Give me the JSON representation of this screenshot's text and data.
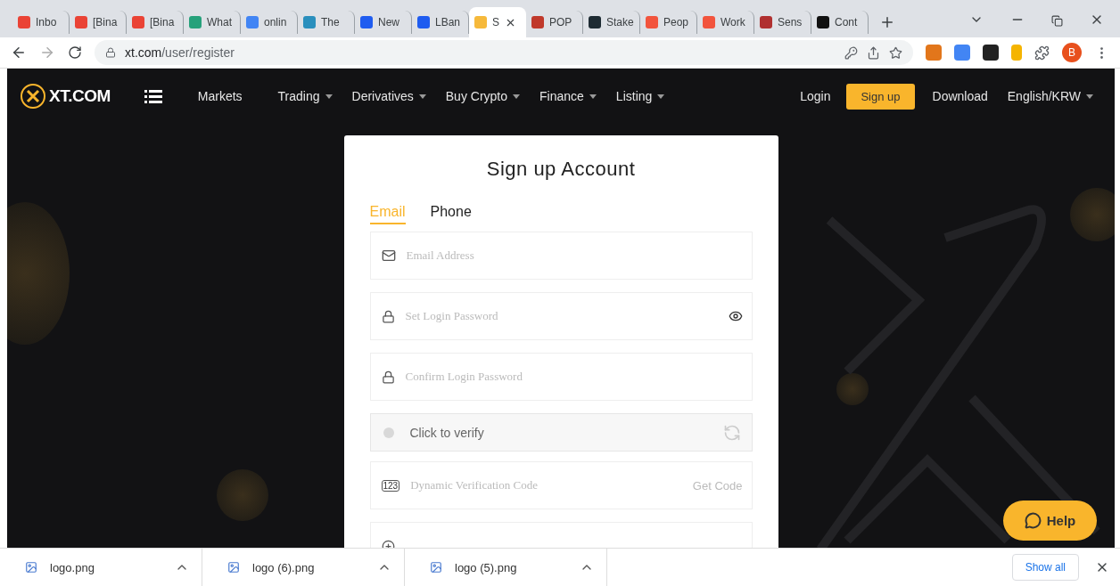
{
  "browser": {
    "tabs": [
      {
        "title": "Inbo",
        "color": "#ea4335",
        "selected": false
      },
      {
        "title": "[Bina",
        "color": "#ea4335",
        "selected": false
      },
      {
        "title": "[Bina",
        "color": "#ea4335",
        "selected": false
      },
      {
        "title": "What",
        "color": "#26a17b",
        "selected": false
      },
      {
        "title": "onlin",
        "color": "#4285f4",
        "selected": false
      },
      {
        "title": "The",
        "color": "#2a8fbd",
        "selected": false
      },
      {
        "title": "New",
        "color": "#1f5cf0",
        "selected": false
      },
      {
        "title": "LBan",
        "color": "#1f5cf0",
        "selected": false
      },
      {
        "title": "S",
        "color": "#f6b93b",
        "selected": true
      },
      {
        "title": "POP",
        "color": "#c0392b",
        "selected": false
      },
      {
        "title": "Stake",
        "color": "#1e2b33",
        "selected": false
      },
      {
        "title": "Peop",
        "color": "#f2543d",
        "selected": false
      },
      {
        "title": "Work",
        "color": "#f2543d",
        "selected": false
      },
      {
        "title": "Sens",
        "color": "#b03030",
        "selected": false
      },
      {
        "title": "Cont",
        "color": "#111111",
        "selected": false
      }
    ],
    "address": {
      "host": "xt.com",
      "path": "/user/register"
    },
    "profile": "B"
  },
  "nav": {
    "logo": "XT.COM",
    "items": [
      {
        "label": "Markets",
        "dropdown": false
      },
      {
        "label": "Trading",
        "dropdown": true
      },
      {
        "label": "Derivatives",
        "dropdown": true
      },
      {
        "label": "Buy Crypto",
        "dropdown": true
      },
      {
        "label": "Finance",
        "dropdown": true
      },
      {
        "label": "Listing",
        "dropdown": true
      }
    ],
    "login": "Login",
    "signup": "Sign up",
    "download": "Download",
    "language": "English/KRW"
  },
  "form": {
    "title": "Sign up Account",
    "tabs": [
      {
        "label": "Email",
        "selected": true
      },
      {
        "label": "Phone",
        "selected": false
      }
    ],
    "fields": [
      {
        "kind": "email",
        "placeholder": "Email Address"
      },
      {
        "kind": "password",
        "placeholder": "Set Login Password",
        "reveal": true
      },
      {
        "kind": "password",
        "placeholder": "Confirm Login Password",
        "reveal": false
      },
      {
        "kind": "captcha",
        "label": "Click to verify"
      },
      {
        "kind": "code",
        "icon_text": "123",
        "placeholder": "Dynamic Verification Code",
        "action": "Get Code"
      },
      {
        "kind": "invite"
      }
    ]
  },
  "help": "Help",
  "downloads": {
    "files": [
      {
        "name": "logo.png"
      },
      {
        "name": "logo (6).png"
      },
      {
        "name": "logo (5).png"
      }
    ],
    "show_all": "Show all"
  }
}
